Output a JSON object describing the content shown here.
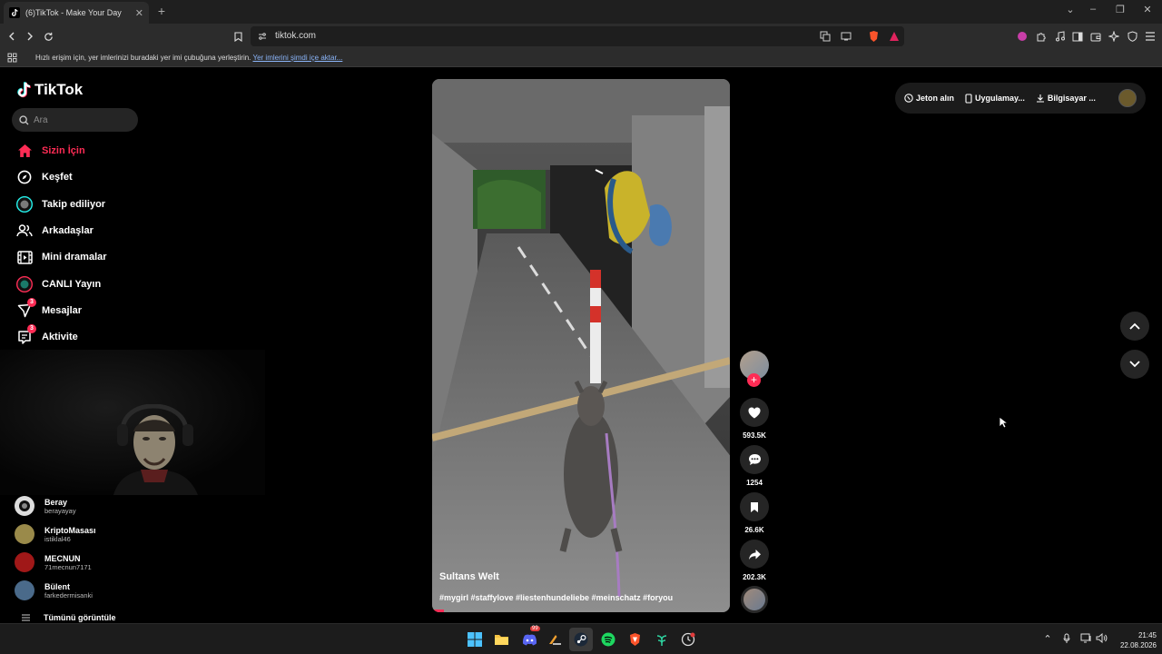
{
  "browser": {
    "tab_title": "(6)TikTok - Make Your Day",
    "url": "tiktok.com",
    "bookmarks_message": "Hızlı erişim için, yer imlerinizi buradaki yer imi çubuğuna yerleştirin.",
    "bookmarks_link": "Yer imlerini şimdi içe aktar..."
  },
  "tiktok": {
    "logo_text": "TikTok",
    "search_placeholder": "Ara",
    "nav": [
      {
        "label": "Sizin İçin",
        "icon": "home-icon",
        "active": true
      },
      {
        "label": "Keşfet",
        "icon": "compass-icon"
      },
      {
        "label": "Takip ediliyor",
        "icon": "following-icon"
      },
      {
        "label": "Arkadaşlar",
        "icon": "friends-icon"
      },
      {
        "label": "Mini dramalar",
        "icon": "film-icon"
      },
      {
        "label": "CANLI Yayın",
        "icon": "live-icon"
      },
      {
        "label": "Mesajlar",
        "icon": "send-icon",
        "badge": "3"
      },
      {
        "label": "Aktivite",
        "icon": "inbox-icon",
        "badge": "3"
      }
    ],
    "following": [
      {
        "name": "Beray",
        "handle": "berayayay",
        "color": "#d9d9d9"
      },
      {
        "name": "KriptoMasası",
        "handle": "istiklal46",
        "color": "#9a8a4a"
      },
      {
        "name": "MECNUN",
        "handle": "71mecnun7171",
        "color": "#a01818"
      },
      {
        "name": "Bülent",
        "handle": "farkedermisanki",
        "color": "#4a6a8a"
      }
    ],
    "see_all": "Tümünü görüntüle",
    "video": {
      "author": "Sultans Welt",
      "hashtags": "#mygirl #staffylove #liestenhundeliebe #meinschatz #foryou",
      "progress": 0.04
    },
    "actions": {
      "likes": "593.5K",
      "comments": "1254",
      "saves": "26.6K",
      "shares": "202.3K"
    },
    "top_right": {
      "coins": "Jeton alın",
      "app": "Uygulamay...",
      "desktop": "Bilgisayar ..."
    }
  },
  "taskbar": {
    "time": "21:45",
    "date": "22.08.2026",
    "discord_badge": "99"
  },
  "colors": {
    "accent": "#fe2c55",
    "background": "#000000"
  }
}
